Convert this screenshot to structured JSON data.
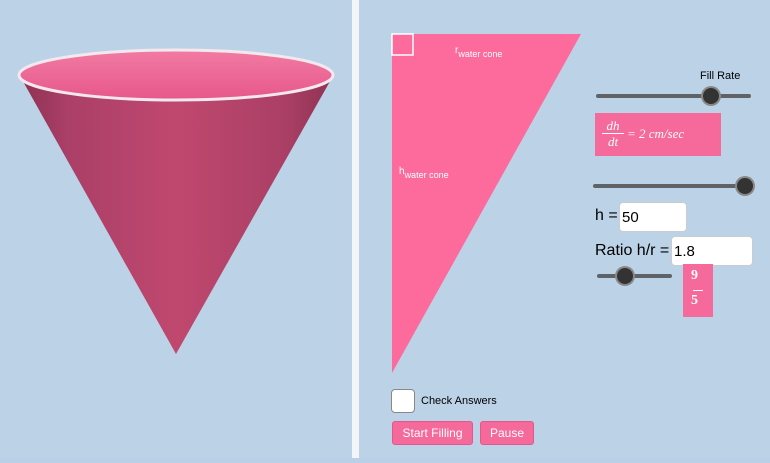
{
  "left": {
    "cone_alt": "3D water cone"
  },
  "diagram": {
    "r_label_main": "r",
    "r_label_sub": "water cone",
    "h_label_main": "h",
    "h_label_sub": "water cone"
  },
  "controls": {
    "fill_rate_label": "Fill Rate",
    "fill_rate_level": 0.9,
    "rate_equation": {
      "numerator": "dh",
      "denominator": "dt",
      "rhs": "= 2 cm/sec"
    },
    "second_slider_level": 1.0,
    "h_label": "h =",
    "h_value": "50",
    "ratio_label": "Ratio h/r =",
    "ratio_value": "1.8",
    "ratio_slider_level": 0.35,
    "ratio_fraction": {
      "numerator": "9",
      "denominator": "5"
    }
  },
  "bottom": {
    "check_answers_label": "Check Answers",
    "start_button": "Start Filling",
    "pause_button": "Pause"
  },
  "colors": {
    "cone": "#b8456c",
    "cone_inner": "#ef6f9c",
    "triangle": "#fd6b9c",
    "accent": "#f6699b",
    "background": "#bcd3e7"
  }
}
